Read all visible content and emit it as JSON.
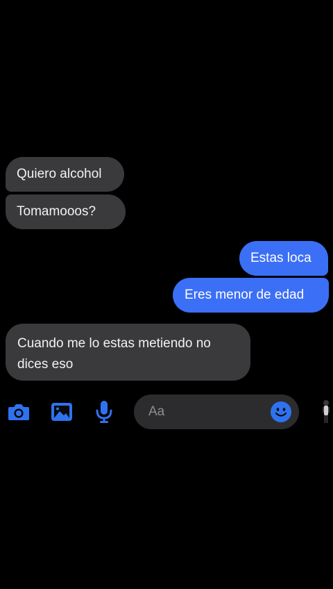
{
  "messages": [
    {
      "id": "m1",
      "direction": "incoming",
      "text": "Quiero alcohol"
    },
    {
      "id": "m2",
      "direction": "incoming",
      "text": "Tomamooos?"
    },
    {
      "id": "m3",
      "direction": "outgoing",
      "text": "Estas loca"
    },
    {
      "id": "m4",
      "direction": "outgoing",
      "text": "Eres menor de edad"
    },
    {
      "id": "m5",
      "direction": "incoming",
      "text": "Cuando me lo estas metiendo no dices eso"
    }
  ],
  "composer": {
    "placeholder": "Aa",
    "icons": [
      "camera-icon",
      "image-icon",
      "microphone-icon",
      "smiley-icon",
      "figure-icon"
    ]
  },
  "colors": {
    "background": "#000000",
    "incoming_bubble": "#3a3a3c",
    "outgoing_bubble": "#3b6ff5",
    "accent": "#2f72f0",
    "input_background": "#2c2c2e",
    "placeholder_text": "#8e8e93"
  }
}
